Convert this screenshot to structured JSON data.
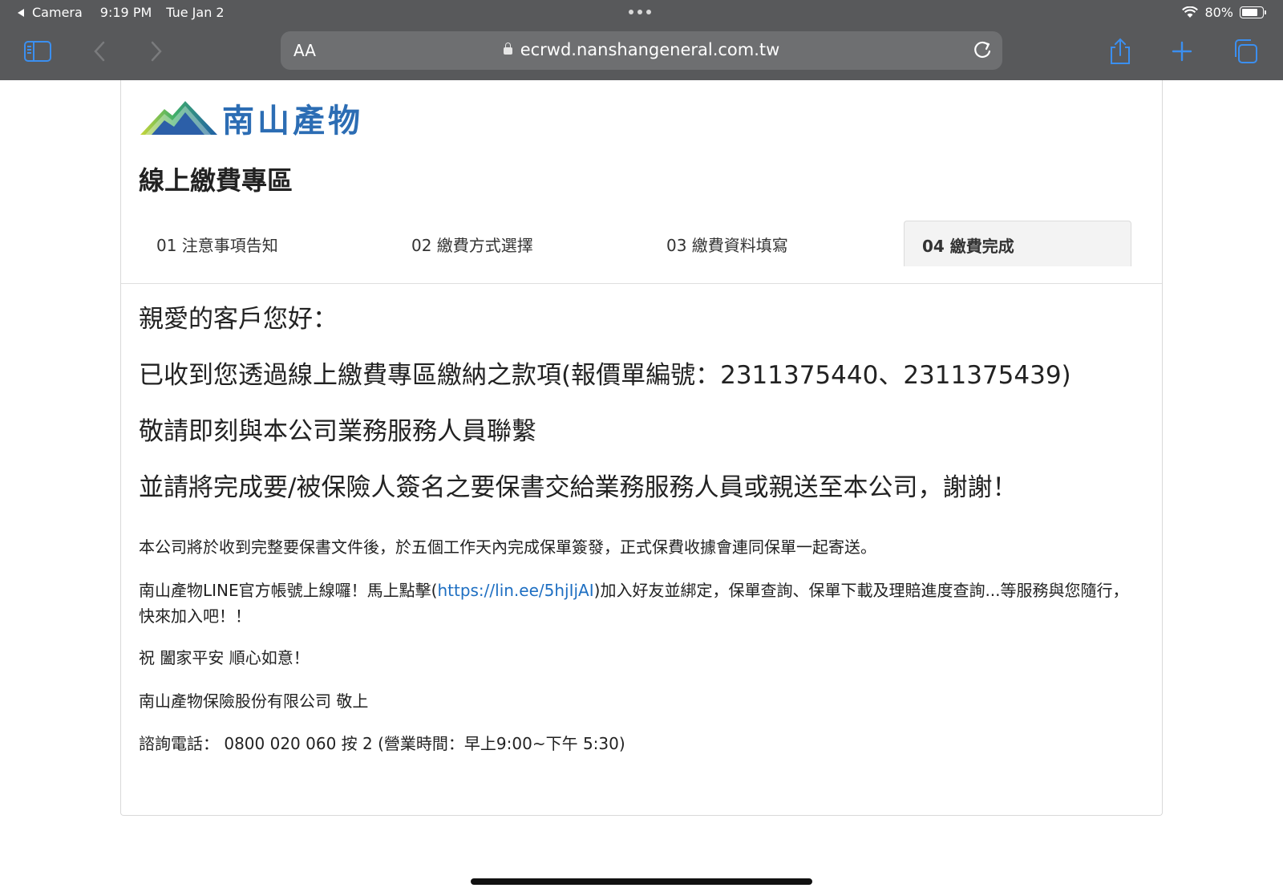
{
  "status_bar": {
    "back_app": "Camera",
    "time": "9:19 PM",
    "date": "Tue Jan 2",
    "battery": "80%",
    "battery_level": 0.8
  },
  "browser": {
    "aa_label": "AA",
    "url": "ecrwd.nanshangeneral.com.tw",
    "icons": [
      "sidebar-icon",
      "back-icon",
      "forward-icon",
      "lock-icon",
      "reload-icon",
      "share-icon",
      "new-tab-icon",
      "tabs-icon"
    ]
  },
  "page": {
    "logo_text": "南山產物",
    "title": "線上繳費專區",
    "steps": [
      {
        "label": "01 注意事項告知"
      },
      {
        "label": "02 繳費方式選擇"
      },
      {
        "label": "03 繳費資料填寫"
      },
      {
        "label": "04 繳費完成"
      }
    ],
    "active_step": 4,
    "greeting": "親愛的客戶您好：",
    "received": "已收到您透過線上繳費專區繳納之款項(報價單編號：2311375440、2311375439)",
    "contact": "敬請即刻與本公司業務服務人員聯繫",
    "sign": "並請將完成要/被保險人簽名之要保書交給業務服務人員或親送至本公司，謝謝！",
    "note_issue": "本公司將於收到完整要保書文件後，於五個工作天內完成保單簽發，正式保費收據會連同保單一起寄送。",
    "line_before": "南山產物LINE官方帳號上線囉！馬上點擊(",
    "line_link": "https://lin.ee/5hjIjAI",
    "line_after": ")加入好友並綁定，保單查詢、保單下載及理賠進度查詢...等服務與您隨行，快來加入吧！！",
    "wish": "祝 闔家平安 順心如意！",
    "company": "南山產物保險股份有限公司 敬上",
    "phone": "諮詢電話： 0800 020 060 按 2 (營業時間：早上9:00~下午 5:30)"
  }
}
